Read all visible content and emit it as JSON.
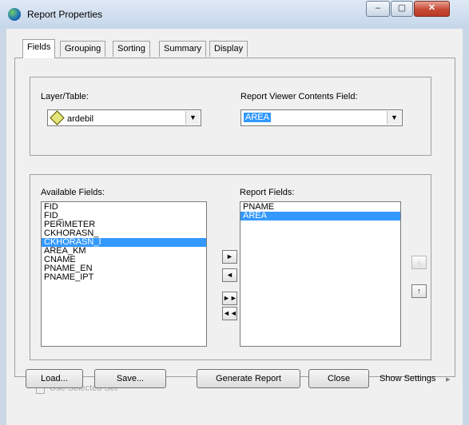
{
  "window": {
    "title": "Report Properties",
    "controls": {
      "minimize": "–",
      "maximize": "▢",
      "close": "✕"
    }
  },
  "tabs": [
    {
      "label": "Fields",
      "active": true
    },
    {
      "label": "Grouping"
    },
    {
      "label": "Sorting"
    },
    {
      "label": "Summary"
    },
    {
      "label": "Display"
    }
  ],
  "layer": {
    "label": "Layer/Table:",
    "value": "ardebil",
    "icon": "diamond-layer-icon"
  },
  "contents": {
    "label": "Report Viewer Contents Field:",
    "value": "AREA"
  },
  "available": {
    "label": "Available Fields:",
    "items": [
      "FID",
      "FID_",
      "PERIMETER",
      "CKHORASN_",
      "CKHORASN_I",
      "AREA_KM",
      "CNAME",
      "PNAME_EN",
      "PNAME_IPT"
    ],
    "selected_index": 4
  },
  "report": {
    "label": "Report Fields:",
    "items": [
      "PNAME",
      "AREA"
    ],
    "selected_index": 1
  },
  "move": {
    "add": "►",
    "remove": "◄",
    "add_all": "►►",
    "remove_all": "◄◄"
  },
  "order": {
    "up": "↓",
    "down": "↑"
  },
  "use_selected": {
    "label": "Use Selected Set",
    "checked": false
  },
  "buttons": {
    "load": "Load...",
    "save": "Save...",
    "generate": "Generate Report",
    "close": "Close"
  },
  "show_settings": {
    "label": "Show Settings",
    "icon": "▸"
  }
}
